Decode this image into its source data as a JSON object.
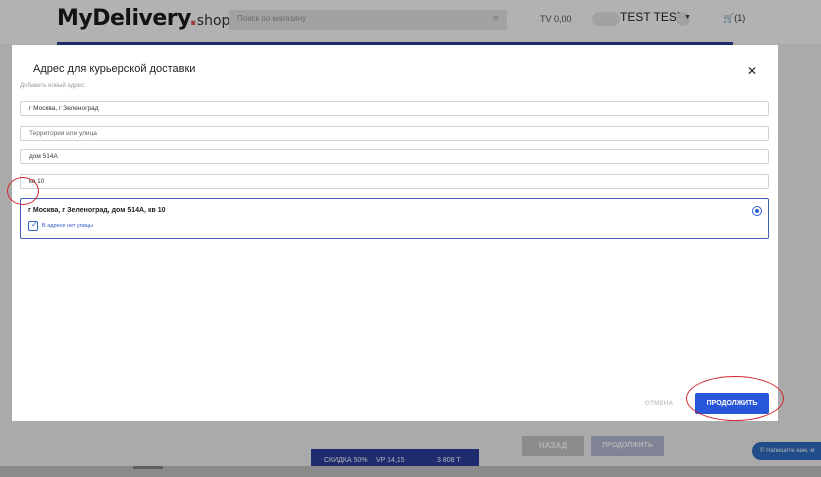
{
  "header": {
    "logo_main": "MyDeliver",
    "logo_y": "y",
    "logo_dot": ".",
    "logo_shop": "shop",
    "search_placeholder": "Поиск по магазину",
    "search_icon": "search-icon",
    "tv": "TV 0,00",
    "user_name": "TEST TEST",
    "cart_label": "(1)",
    "cart_icon": "basket-icon",
    "accent_color": "#2c3e98"
  },
  "modal": {
    "title": "Адрес для курьерской доставки",
    "add_new_hint": "Добавить новый адрес:",
    "fields": [
      {
        "value": "г Москва, г Зеленоград",
        "placeholder": ""
      },
      {
        "value": "",
        "placeholder": "Территория или улица"
      },
      {
        "value": "дом 514А",
        "placeholder": ""
      },
      {
        "value": "кв 10",
        "placeholder": ""
      }
    ],
    "address_summary": "г Москва, г Зеленоград, дом 514А, кв 10",
    "no_street_checkbox_label": "В адресе нет улицы",
    "no_street_checked": true,
    "address_selected": true,
    "cancel_label": "ОТМЕНА",
    "continue_label": "ПРОДОЛЖИТЬ",
    "primary_color": "#2756d8",
    "highlight_color": "#d1262e"
  },
  "background": {
    "back_label": "НАЗАД",
    "continue_label": "ПРОДОЛЖИТЬ",
    "promo": {
      "discount": "СКИДКА 50%",
      "vp": "VP 14,15",
      "price": "3 808 Т"
    },
    "chat_label": "© Напишите нам, м"
  }
}
